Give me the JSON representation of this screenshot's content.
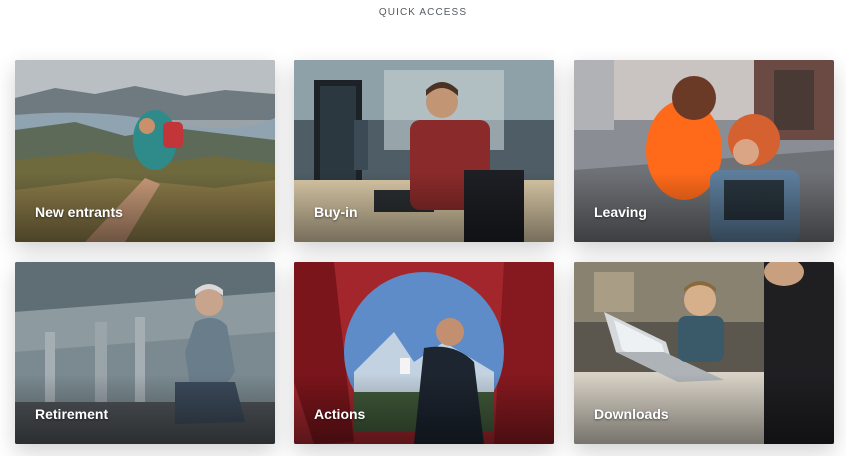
{
  "section": {
    "heading": "QUICK ACCESS"
  },
  "cards": [
    {
      "label": "New entrants"
    },
    {
      "label": "Buy-in"
    },
    {
      "label": "Leaving"
    },
    {
      "label": "Retirement"
    },
    {
      "label": "Actions"
    },
    {
      "label": "Downloads"
    }
  ]
}
